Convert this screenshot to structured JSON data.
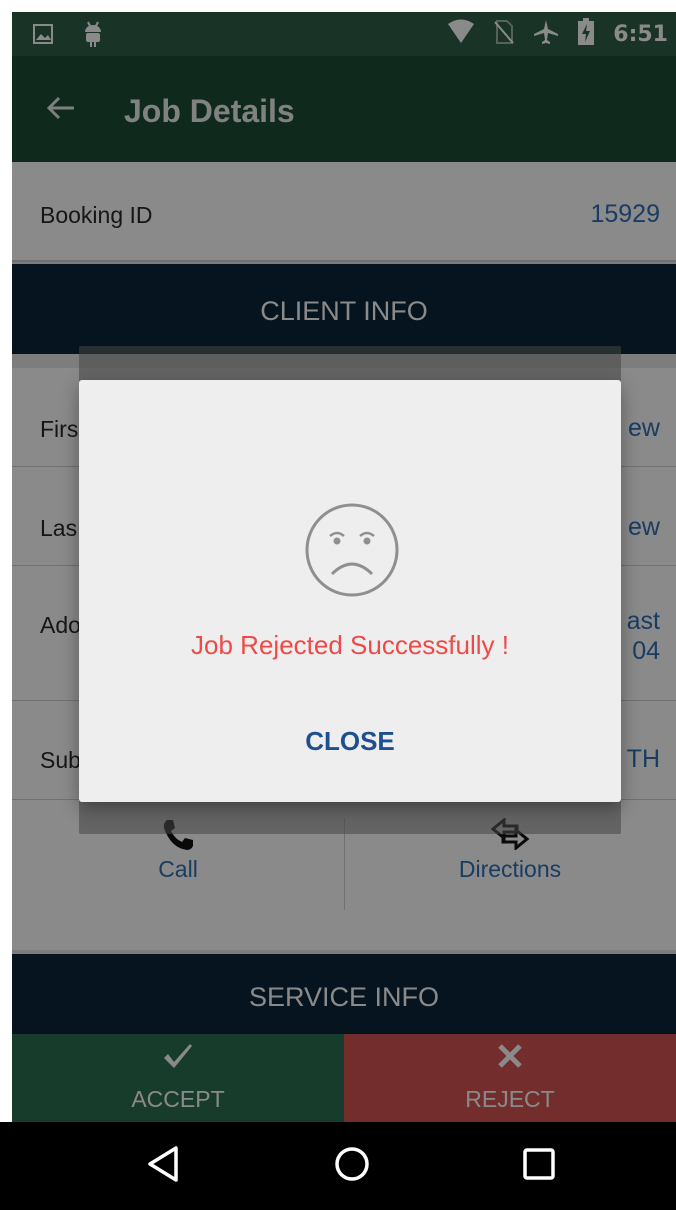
{
  "status_bar": {
    "time": "6:51",
    "icons": [
      "image-icon",
      "android-icon",
      "wifi-icon",
      "no-sim-icon",
      "airplane-icon",
      "battery-charging-icon"
    ]
  },
  "app_bar": {
    "back_icon": "arrow-back-icon",
    "title": "Job Details"
  },
  "booking": {
    "label": "Booking ID",
    "value": "15929"
  },
  "client_info": {
    "section_title": "CLIENT INFO",
    "rows": [
      {
        "label": "Firs",
        "value": "ew"
      },
      {
        "label": "Las",
        "value": "ew"
      },
      {
        "label": "Ado",
        "value": "ast\n04"
      },
      {
        "label": "Sub",
        "value": "TH"
      }
    ],
    "actions": [
      {
        "label": "Call",
        "icon": "phone-icon"
      },
      {
        "label": "Directions",
        "icon": "directions-icon"
      }
    ]
  },
  "service_info": {
    "section_title": "SERVICE INFO"
  },
  "bottom_buttons": {
    "accept_label": "ACCEPT",
    "accept_icon": "checkmark-icon",
    "reject_label": "REJECT",
    "reject_icon": "x-icon"
  },
  "dialog": {
    "icon": "sad-face-icon",
    "message": "Job Rejected Successfully !",
    "close_label": "CLOSE",
    "message_color": "#ee4a47",
    "close_color": "#1e4f8f"
  },
  "nav_bar": {
    "icons": [
      "back-triangle-icon",
      "home-circle-icon",
      "recents-square-icon"
    ]
  },
  "colors": {
    "status_bar": "#2f5f48",
    "app_bar": "#1f4c36",
    "section_header": "#0b2538",
    "accent": "#2f70b6",
    "accept": "#2b6f51",
    "reject": "#d45452"
  }
}
